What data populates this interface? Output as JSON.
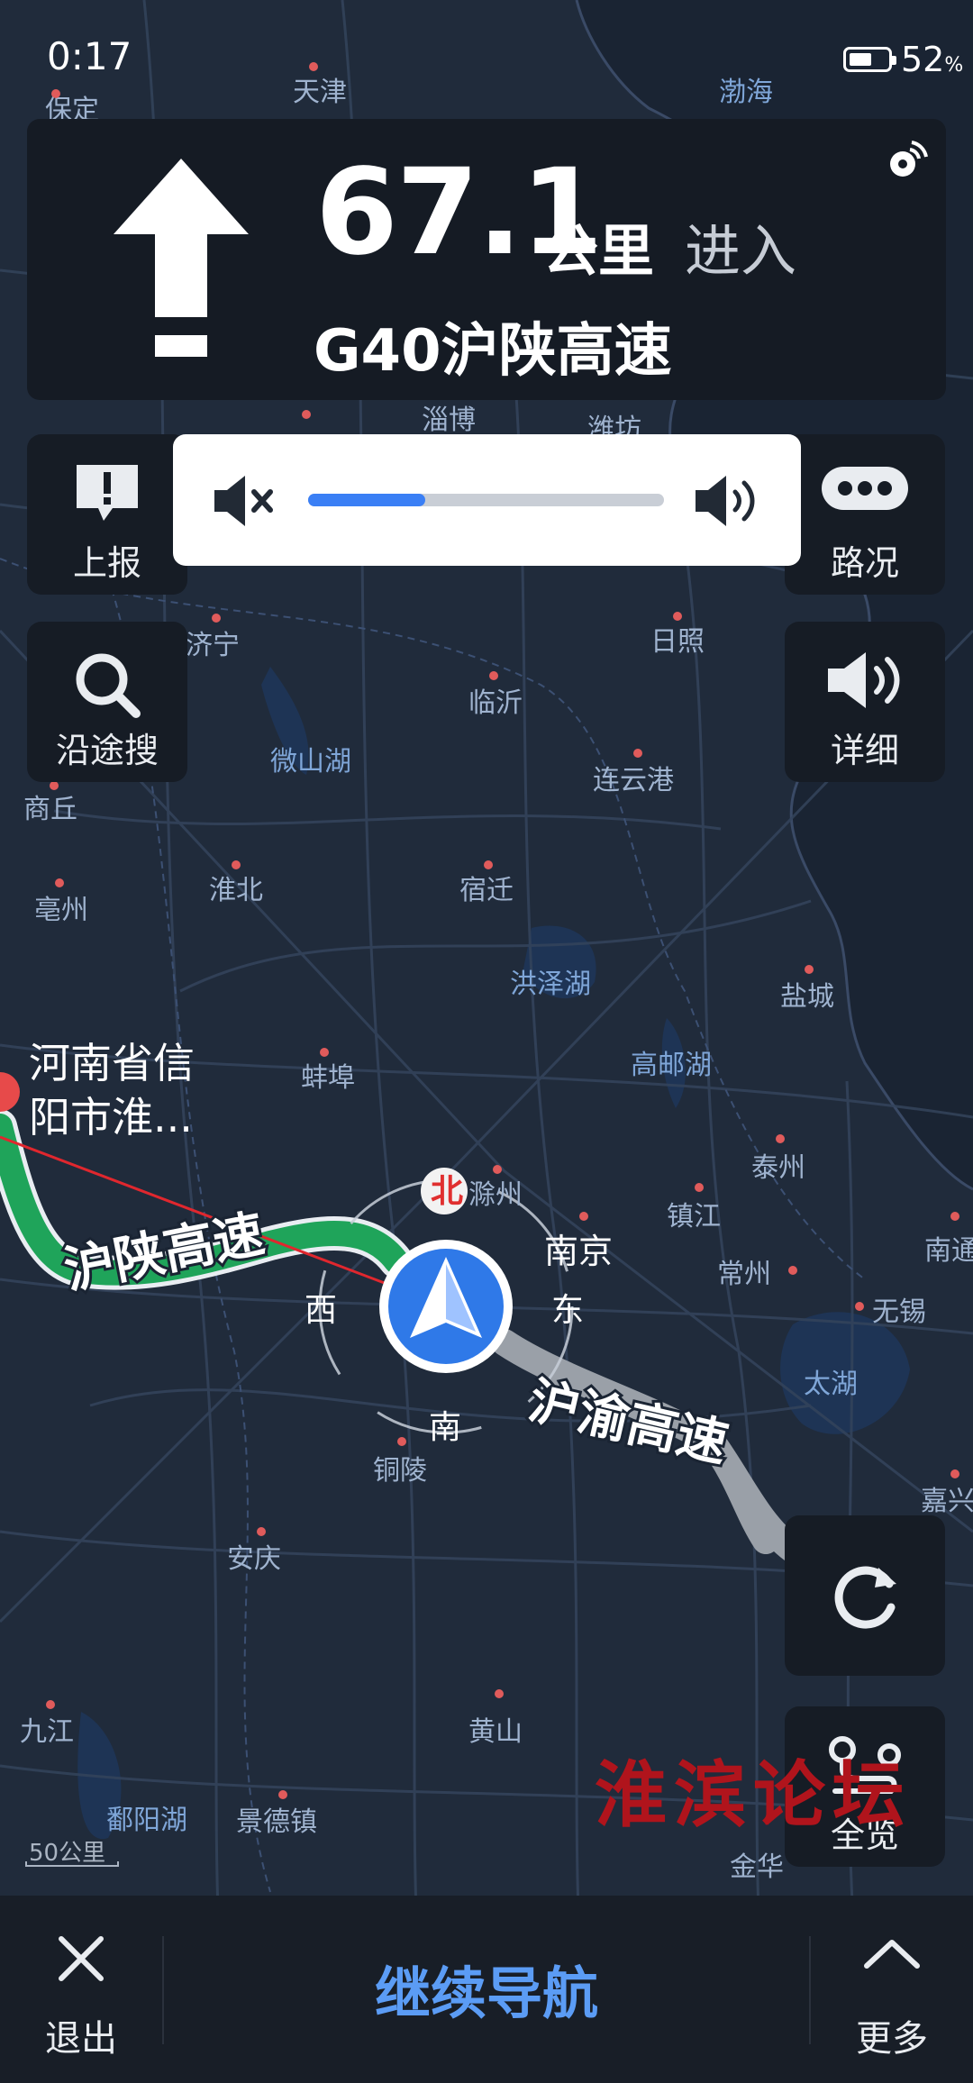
{
  "status_bar": {
    "time": "0:17",
    "battery": "52",
    "battery_unit": "%"
  },
  "guidance": {
    "distance": "67.1",
    "unit": "公里",
    "action": "进入",
    "road": "G40沪陕高速"
  },
  "volume": {
    "level": 0.33
  },
  "buttons": {
    "report": "上报",
    "traffic": "路况",
    "search_along": "沿途搜",
    "detail": "详细",
    "overview": "全览"
  },
  "map": {
    "cities": {
      "tianjin": "天津",
      "bohai": "渤海",
      "baoding": "保定",
      "zibo": "淄博",
      "weifang": "潍坊",
      "jining": "济宁",
      "rizhao": "日照",
      "linyi": "临沂",
      "lianyungang": "连云港",
      "shangqiu": "商丘",
      "bozhou": "亳州",
      "huaibei": "淮北",
      "suqian": "宿迁",
      "yancheng": "盐城",
      "bengbu": "蚌埠",
      "chuzhou": "滁州",
      "nanjing": "南京",
      "zhenjiang": "镇江",
      "taizhou": "泰州",
      "changzhou": "常州",
      "wuxi": "无锡",
      "nantong": "南通",
      "jiaxing": "嘉兴",
      "tongling": "铜陵",
      "anqing": "安庆",
      "jiujiang": "九江",
      "huangshan": "黄山",
      "jingdezhen": "景德镇",
      "jinhua": "金华"
    },
    "lakes": {
      "weishan": "微山湖",
      "hongze": "洪泽湖",
      "gaoyou": "高邮湖",
      "taihu": "太湖",
      "poyang": "鄱阳湖"
    },
    "destination": [
      "河南省信",
      "阳市淮..."
    ],
    "roads": {
      "hushan": "沪陕高速",
      "huyu": "沪渝高速"
    },
    "compass": {
      "north": "北",
      "south": "南",
      "east": "东",
      "west": "西"
    },
    "scale": "50公里"
  },
  "watermark": "淮滨论坛",
  "bottom": {
    "exit": "退出",
    "continue": "继续导航",
    "more": "更多"
  },
  "colors": {
    "route_green": "#1fa45a",
    "route_gray": "#9aa0a8",
    "accent_blue": "#3a7ff5",
    "map_bg": "#1f2a3a"
  }
}
